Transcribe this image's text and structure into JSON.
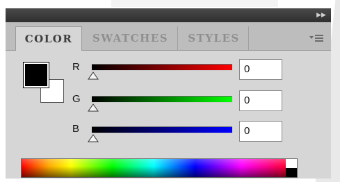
{
  "panel": {
    "tabs": [
      {
        "label": "COLOR",
        "active": true
      },
      {
        "label": "SWATCHES",
        "active": false
      },
      {
        "label": "STYLES",
        "active": false
      }
    ],
    "collapse_icon": "double-chevron-right-icon",
    "menu_icon": "panel-menu-icon"
  },
  "color": {
    "foreground": "#000000",
    "background": "#ffffff",
    "channels": [
      {
        "label": "R",
        "value": "0",
        "color": "#ff0000"
      },
      {
        "label": "G",
        "value": "0",
        "color": "#00ff00"
      },
      {
        "label": "B",
        "value": "0",
        "color": "#0000ff"
      }
    ],
    "spectrum": "rgb-spectrum-ramp"
  }
}
